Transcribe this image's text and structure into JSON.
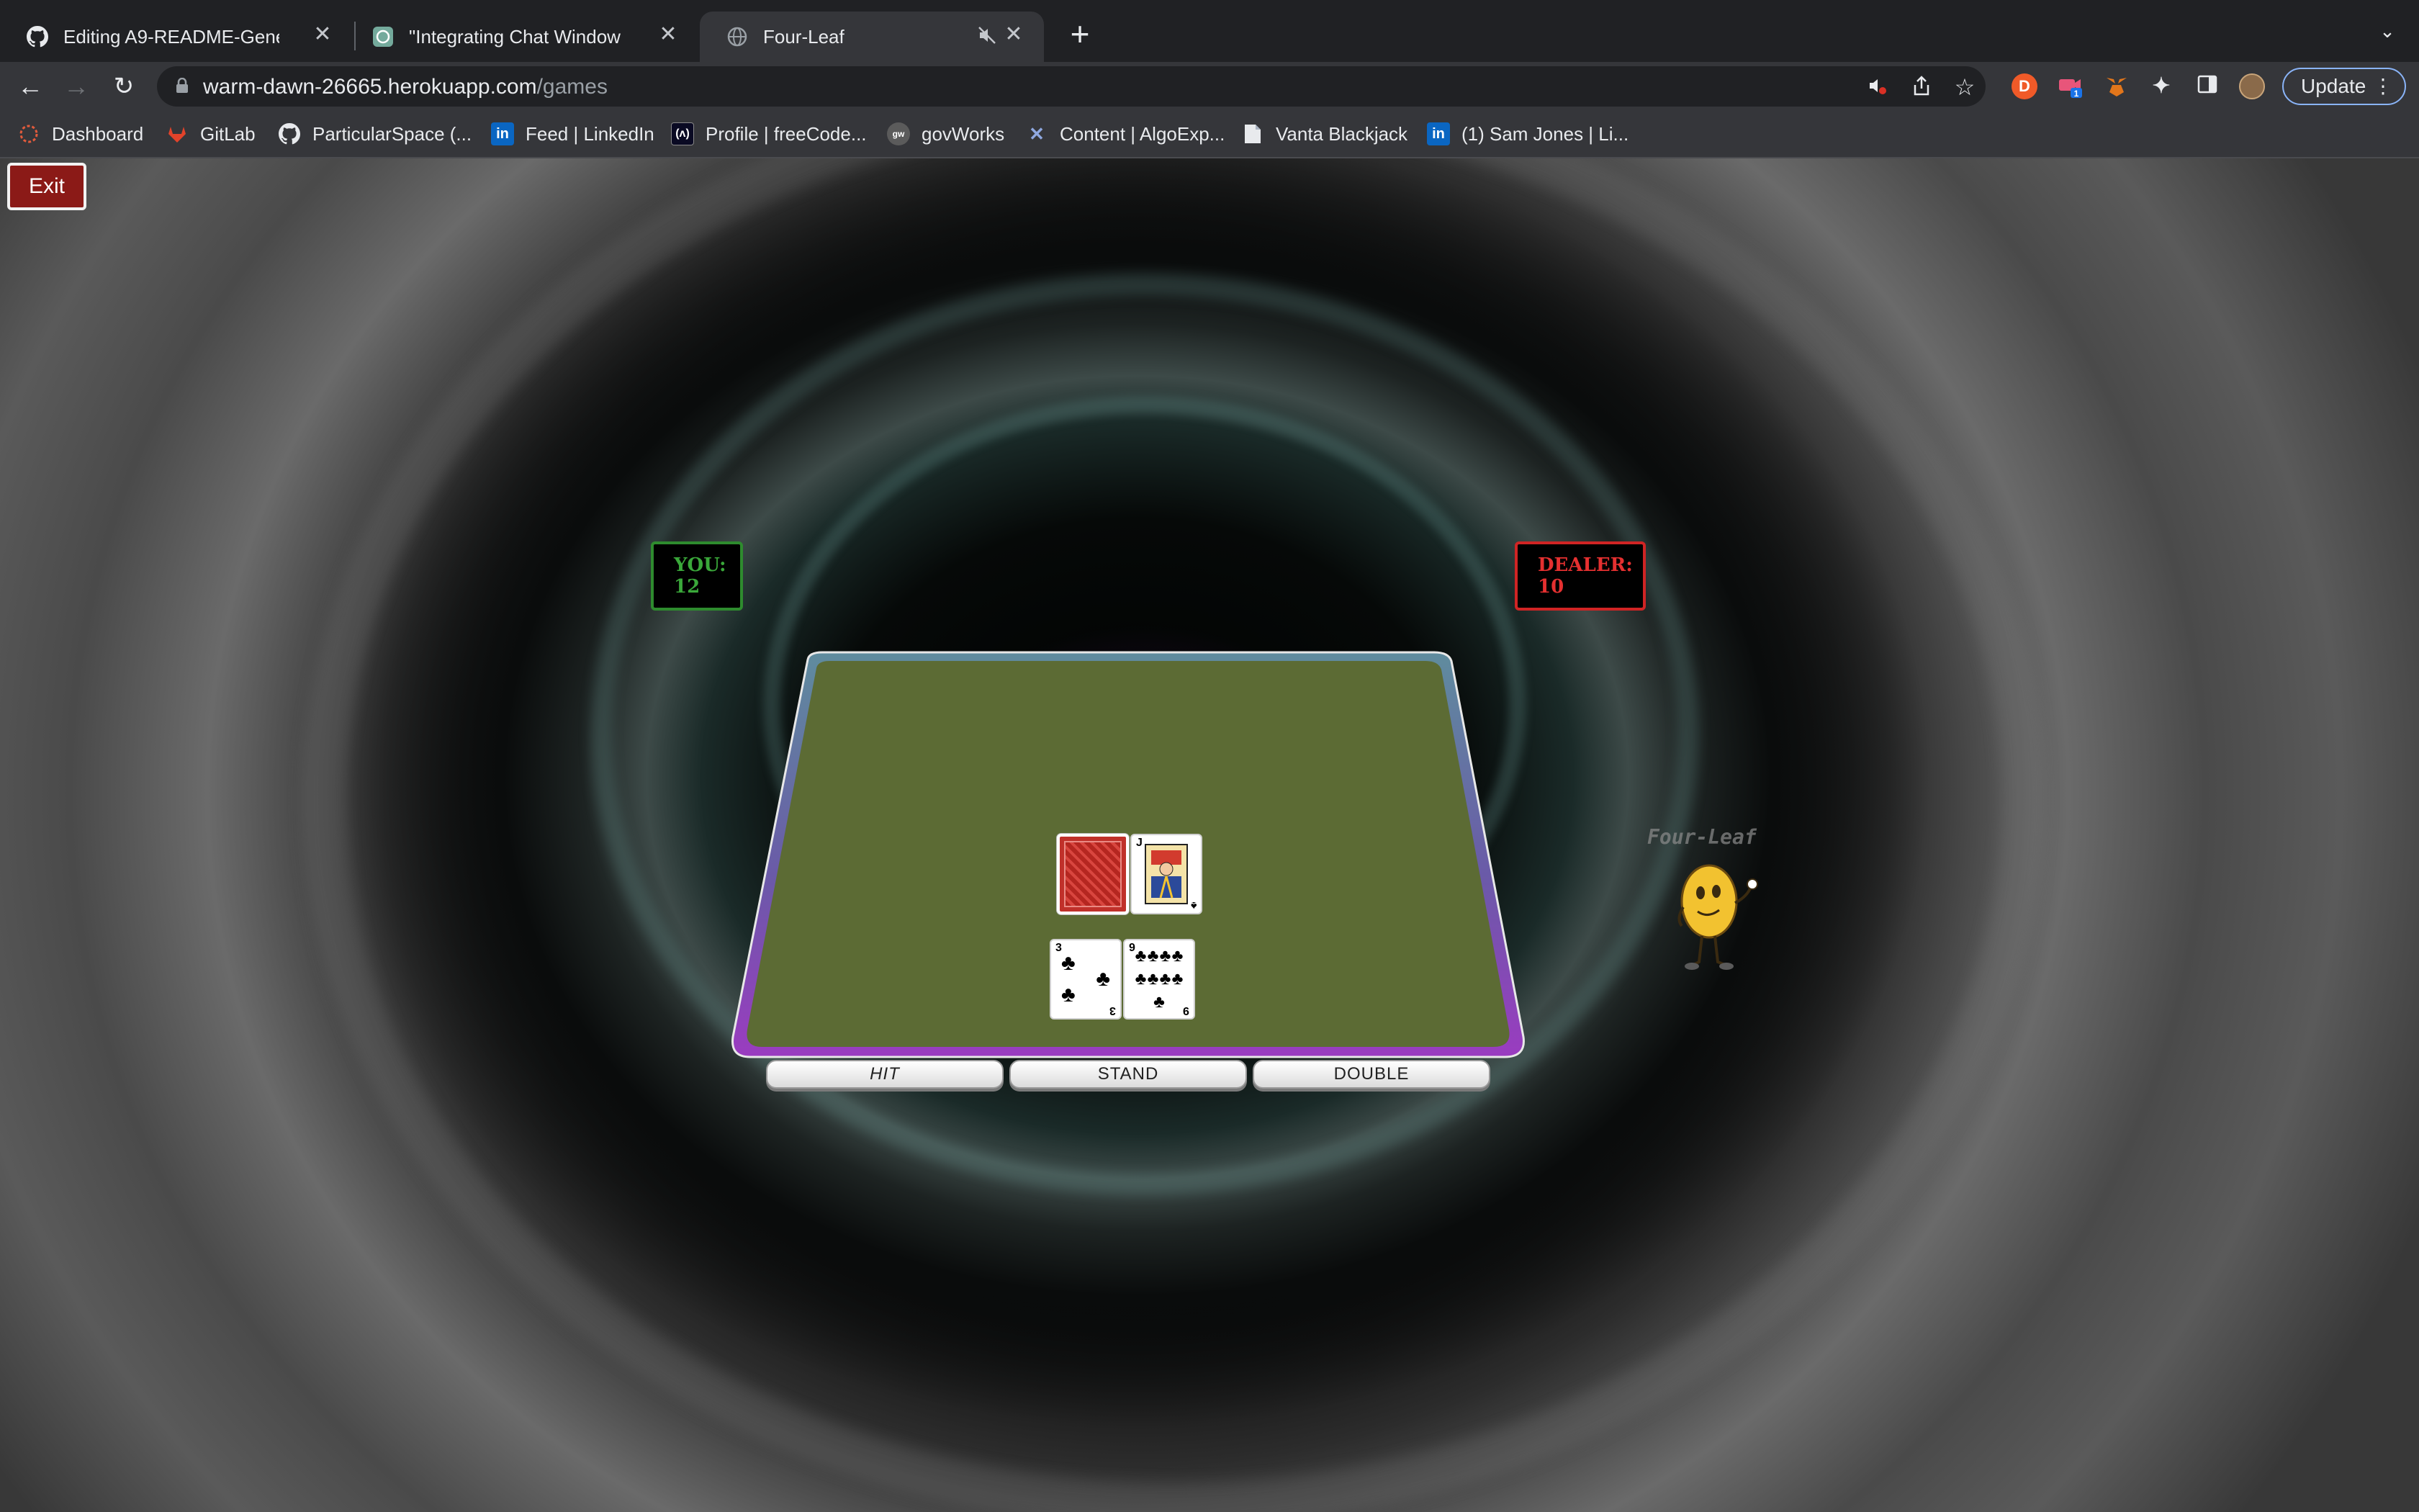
{
  "browser": {
    "tabs": [
      {
        "title": "Editing A9-README-Generator",
        "icon": "github-icon",
        "active": false
      },
      {
        "title": "\"Integrating Chat Window UI\"",
        "icon": "chatgpt-icon",
        "active": false
      },
      {
        "title": "Four-Leaf",
        "icon": "globe-icon",
        "active": true,
        "muted": true
      }
    ],
    "address": {
      "host": "warm-dawn-26665.herokuapp.com",
      "path": "/games"
    },
    "update_label": "Update",
    "bookmarks": [
      {
        "label": "Dashboard",
        "icon": "dashboard-icon",
        "color": "#e25b3c"
      },
      {
        "label": "GitLab",
        "icon": "gitlab-icon",
        "color": "#e2432a"
      },
      {
        "label": "ParticularSpace (...",
        "icon": "github-icon",
        "color": "#ffffff"
      },
      {
        "label": "Feed | LinkedIn",
        "icon": "linkedin-icon",
        "color": "#0a66c2"
      },
      {
        "label": "Profile | freeCode...",
        "icon": "freecodecamp-icon",
        "color": "#0a0a23"
      },
      {
        "label": "govWorks",
        "icon": "govworks-icon",
        "color": "#6b6b6b"
      },
      {
        "label": "Content | AlgoExp...",
        "icon": "algoexpert-icon",
        "color": "#3b5ea8"
      },
      {
        "label": "Vanta Blackjack",
        "icon": "document-icon",
        "color": "#ffffff"
      },
      {
        "label": "(1) Sam Jones | Li...",
        "icon": "linkedin-icon",
        "color": "#0a66c2"
      }
    ]
  },
  "game": {
    "exit_label": "Exit",
    "player": {
      "label": "YOU:",
      "score": "12",
      "color": "#3aa83a"
    },
    "dealer": {
      "label": "DEALER:",
      "score": "10",
      "color": "#e53030"
    },
    "dealer_cards": [
      {
        "face": "back"
      },
      {
        "rank": "J",
        "suit": "♠"
      }
    ],
    "player_cards": [
      {
        "rank": "3",
        "suit": "♣"
      },
      {
        "rank": "9",
        "suit": "♣"
      }
    ],
    "buttons": {
      "hit": "HIT",
      "stand": "STAND",
      "double": "DOUBLE"
    },
    "mascot_label": "Four-Leaf",
    "colors": {
      "felt": "#5c6b34",
      "rim_purple": "#8e3bb0",
      "rim_teal": "#4e8fa0",
      "exit": "#8b1a17"
    }
  }
}
